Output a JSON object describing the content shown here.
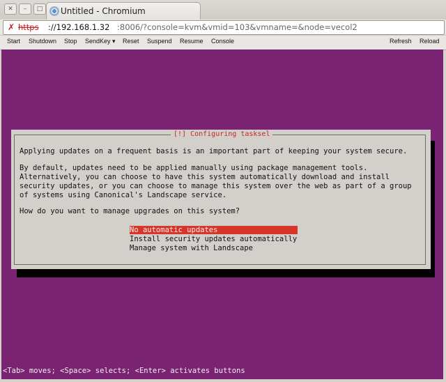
{
  "window": {
    "tab_title": "Untitled - Chromium",
    "tab_icon": "chromium-icon"
  },
  "address_bar": {
    "scheme": "https",
    "host": "://192.168.1.32",
    "rest": ":8006/?console=kvm&vmid=103&vmname=&node=vecol2",
    "insecure_icon": "x-icon"
  },
  "toolbar": {
    "start": "Start",
    "shutdown": "Shutdown",
    "stop": "Stop",
    "sendkey": "SendKey",
    "sendkey_arrow": "▾",
    "reset": "Reset",
    "suspend": "Suspend",
    "resume": "Resume",
    "console": "Console",
    "refresh": "Refresh",
    "reload": "Reload"
  },
  "dialog": {
    "title": "[!] Configuring tasksel",
    "paragraph1": "Applying updates on a frequent basis is an important part of keeping your system secure.",
    "paragraph2_lines": [
      "By default, updates need to be applied manually using package management tools.",
      "Alternatively, you can choose to have this system automatically download and install",
      "security updates, or you can choose to manage this system over the web as part of a group",
      "of systems using Canonical's Landscape service."
    ],
    "question": "How do you want to manage upgrades on this system?",
    "options": [
      "No automatic updates",
      "Install security updates automatically",
      "Manage system with Landscape"
    ],
    "selected_index": 0
  },
  "status_line": "<Tab> moves; <Space> selects; <Enter> activates buttons",
  "colors": {
    "console_background": "#7a2372",
    "dialog_background": "#d3d0cc",
    "selection": "#d8352a",
    "title_red": "#c22a23"
  }
}
